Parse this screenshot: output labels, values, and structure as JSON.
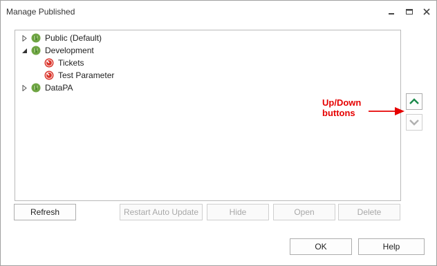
{
  "window": {
    "title": "Manage Published"
  },
  "tree": {
    "nodes": [
      {
        "label": "Public (Default)",
        "expander": "collapsed",
        "icon": "green-published-icon"
      },
      {
        "label": "Development",
        "expander": "expanded",
        "icon": "green-published-icon"
      },
      {
        "label": "Tickets",
        "expander": "none",
        "icon": "red-gauge-icon"
      },
      {
        "label": "Test Parameter",
        "expander": "none",
        "icon": "red-gauge-icon"
      },
      {
        "label": "DataPA",
        "expander": "collapsed",
        "icon": "green-published-icon"
      }
    ]
  },
  "actions": {
    "refresh": "Refresh",
    "restart_auto_update": "Restart Auto Update",
    "hide": "Hide",
    "open": "Open",
    "delete": "Delete"
  },
  "dialog": {
    "ok": "OK",
    "help": "Help"
  },
  "annotation": {
    "line1": "Up/Down",
    "line2": "buttons",
    "color": "#e60000"
  },
  "colors": {
    "up_arrow": "#1a8a4a",
    "down_arrow_disabled": "#b0b0b0"
  }
}
